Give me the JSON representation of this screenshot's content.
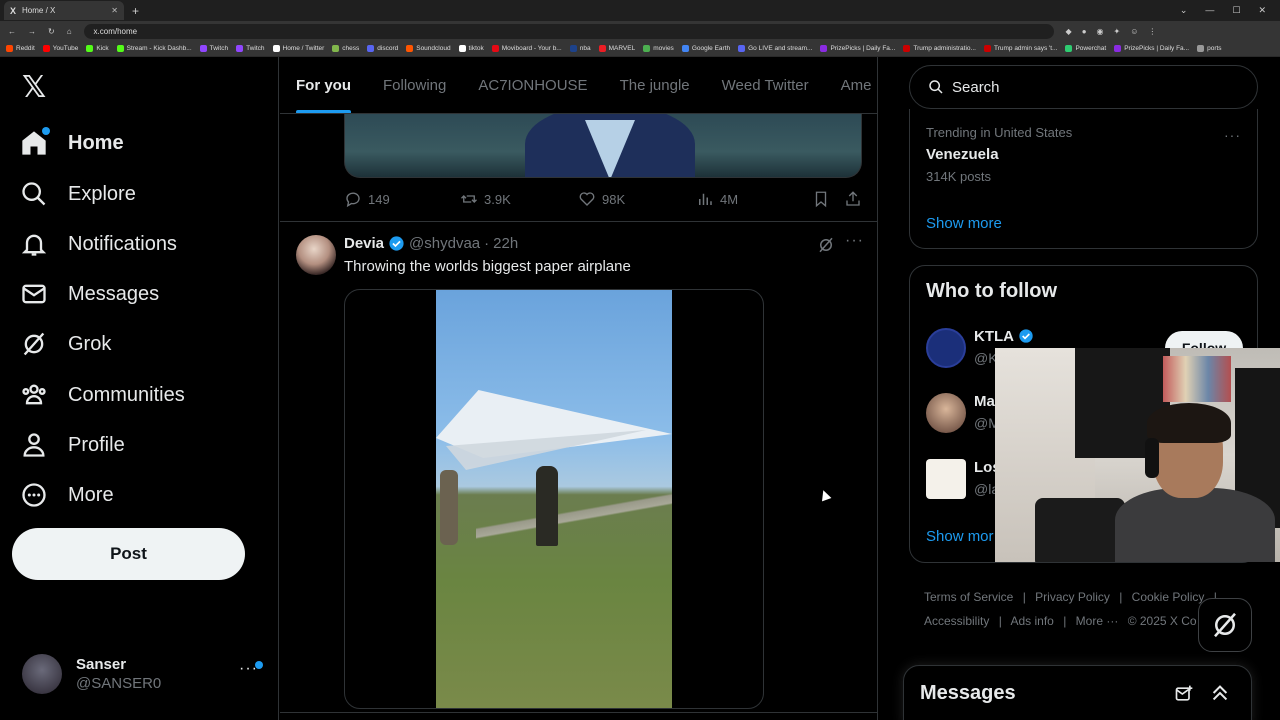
{
  "browser": {
    "tab_title": "Home / X",
    "url": "x.com/home",
    "bookmarks": [
      {
        "label": "Reddit",
        "color": "#ff4500"
      },
      {
        "label": "YouTube",
        "color": "#ff0000"
      },
      {
        "label": "Kick",
        "color": "#53fc18"
      },
      {
        "label": "Stream - Kick Dashb...",
        "color": "#53fc18"
      },
      {
        "label": "Twitch",
        "color": "#9146ff"
      },
      {
        "label": "Twitch",
        "color": "#9146ff"
      },
      {
        "label": "Home / Twitter",
        "color": "#ffffff"
      },
      {
        "label": "chess",
        "color": "#81b64c"
      },
      {
        "label": "discord",
        "color": "#5865f2"
      },
      {
        "label": "Soundcloud",
        "color": "#ff5500"
      },
      {
        "label": "tiktok",
        "color": "#ffffff"
      },
      {
        "label": "Moviboard - Your b...",
        "color": "#e50914"
      },
      {
        "label": "nba",
        "color": "#1d428a"
      },
      {
        "label": "MARVEL",
        "color": "#ec1d24"
      },
      {
        "label": "movies",
        "color": "#4caf50"
      },
      {
        "label": "Google Earth",
        "color": "#4285f4"
      },
      {
        "label": "Go LIVE and stream...",
        "color": "#5865f2"
      },
      {
        "label": "PrizePicks | Daily Fa...",
        "color": "#8a2be2"
      },
      {
        "label": "Trump administratio...",
        "color": "#cc0000"
      },
      {
        "label": "Trump admin says 't...",
        "color": "#cc0000"
      },
      {
        "label": "Powerchat",
        "color": "#2ecc71"
      },
      {
        "label": "PrizePicks | Daily Fa...",
        "color": "#8a2be2"
      },
      {
        "label": "ports",
        "color": "#999999"
      }
    ]
  },
  "nav": {
    "items": [
      {
        "label": "Home",
        "icon": "home-icon"
      },
      {
        "label": "Explore",
        "icon": "search-icon"
      },
      {
        "label": "Notifications",
        "icon": "bell-icon"
      },
      {
        "label": "Messages",
        "icon": "envelope-icon"
      },
      {
        "label": "Grok",
        "icon": "grok-icon"
      },
      {
        "label": "Communities",
        "icon": "people-icon"
      },
      {
        "label": "Profile",
        "icon": "person-icon"
      },
      {
        "label": "More",
        "icon": "more-circle-icon"
      }
    ],
    "post_label": "Post",
    "account": {
      "name": "Sanser",
      "handle": "@SANSER0"
    }
  },
  "feed": {
    "tabs": [
      "For you",
      "Following",
      "AC7IONHOUSE",
      "The jungle",
      "Weed Twitter",
      "Ame"
    ],
    "prev_tweet_stats": {
      "replies": "149",
      "reposts": "3.9K",
      "likes": "98K",
      "views": "4M"
    },
    "tweet": {
      "name": "Devia",
      "handle": "@shydvaa",
      "sep": "·",
      "time": "22h",
      "text": "Throwing the worlds biggest paper airplane"
    }
  },
  "sidebar": {
    "search_placeholder": "Search",
    "trend": {
      "meta": "Trending in United States",
      "name": "Venezuela",
      "count": "314K posts"
    },
    "show_more": "Show more",
    "who_to_follow": {
      "title": "Who to follow",
      "rows": [
        {
          "name": "KTLA",
          "handle": "@K"
        },
        {
          "name": "Ma",
          "handle": "@M"
        },
        {
          "name": "Los",
          "handle": "@la"
        }
      ],
      "follow_label": "Follow",
      "show_more": "Show mor"
    },
    "footer": [
      "Terms of Service",
      "|",
      "Privacy Policy",
      "|",
      "Cookie Policy",
      "|",
      "Accessibility",
      "|",
      "Ads info",
      "|",
      "More ···",
      "© 2025 X Co"
    ],
    "messages_title": "Messages"
  },
  "colors": {
    "accent": "#1d9bf0",
    "background": "#000000",
    "border": "#2f3336",
    "muted": "#71767b"
  }
}
